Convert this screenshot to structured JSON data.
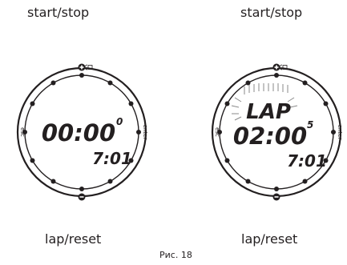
{
  "top_labels": {
    "left": "start/stop",
    "right": "start/stop"
  },
  "bottom_labels": {
    "left": "lap/reset",
    "right": "lap/reset"
  },
  "caption": "Рис. 18",
  "watch_left": {
    "main_time": "00:00",
    "main_sup": "0",
    "sub_time": "7:01",
    "side_left": "esc",
    "side_right": "enter"
  },
  "watch_right": {
    "lap_text": "LAP",
    "main_time": "02:00",
    "main_sup": "5",
    "sub_time": "7:01",
    "side_left": "esc",
    "side_right": "enter"
  }
}
